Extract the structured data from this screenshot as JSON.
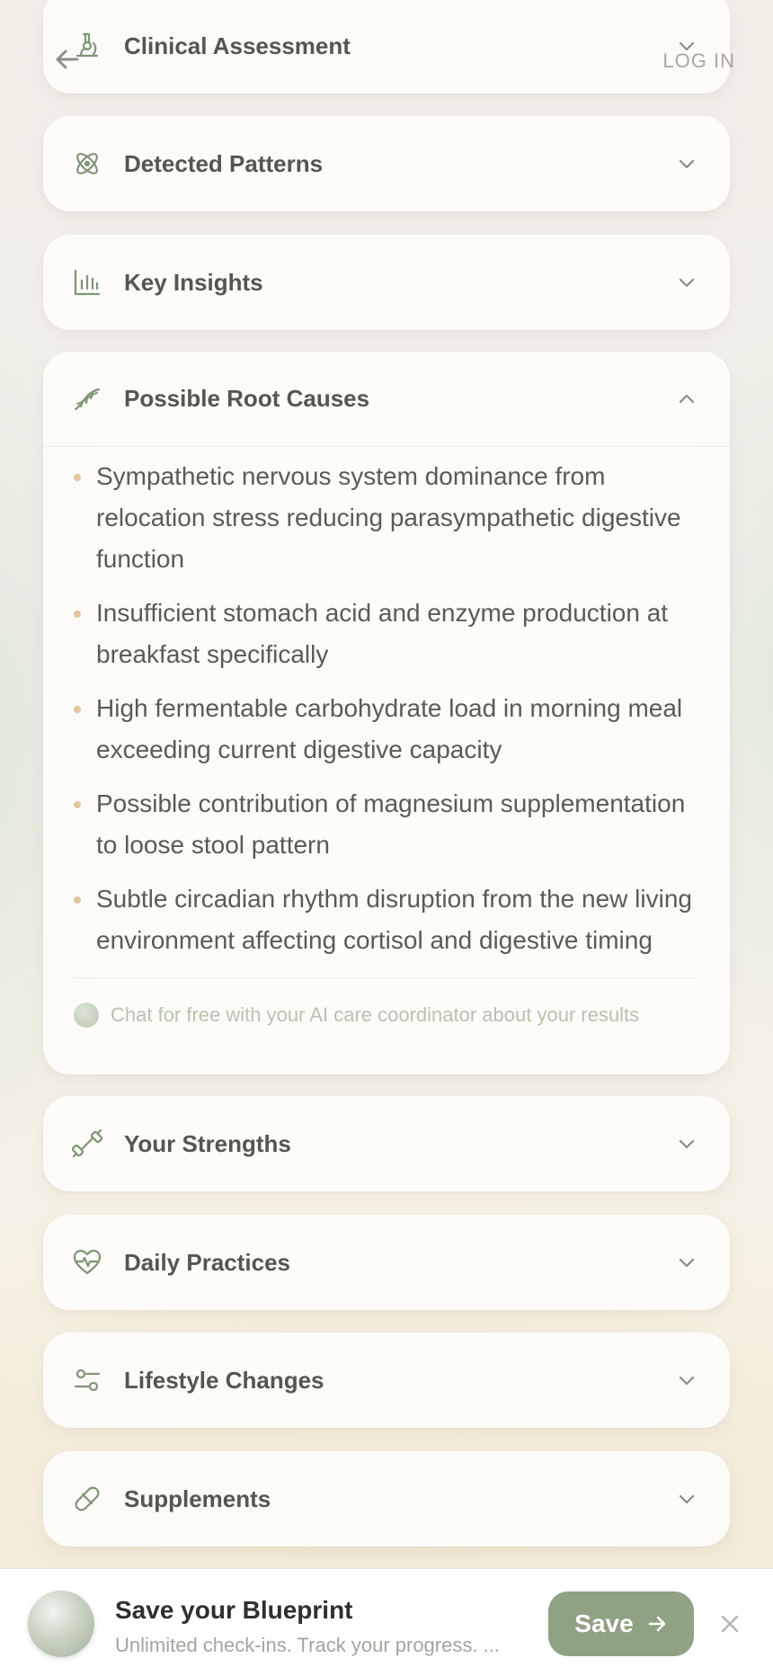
{
  "header": {
    "login_label": "LOG IN"
  },
  "sections": [
    {
      "id": "clinical-assessment",
      "title": "Clinical Assessment",
      "icon": "microscope-icon",
      "expanded": false
    },
    {
      "id": "detected-patterns",
      "title": "Detected Patterns",
      "icon": "atom-icon",
      "expanded": false
    },
    {
      "id": "key-insights",
      "title": "Key Insights",
      "icon": "bar-chart-icon",
      "expanded": false
    },
    {
      "id": "possible-root-causes",
      "title": "Possible Root Causes",
      "icon": "dna-icon",
      "expanded": true,
      "items": [
        "Sympathetic nervous system dominance from relocation stress reducing parasympathetic digestive function",
        "Insufficient stomach acid and enzyme production at breakfast specifically",
        "High fermentable carbohydrate load in morning meal exceeding current digestive capacity",
        "Possible contribution of magnesium supplementation to loose stool pattern",
        "Subtle circadian rhythm disruption from the new living environment affecting cortisol and digestive timing"
      ],
      "chat_prompt": "Chat for free with your AI care coordinator about your results"
    },
    {
      "id": "your-strengths",
      "title": "Your Strengths",
      "icon": "dumbbell-icon",
      "expanded": false
    },
    {
      "id": "daily-practices",
      "title": "Daily Practices",
      "icon": "heart-pulse-icon",
      "expanded": false
    },
    {
      "id": "lifestyle-changes",
      "title": "Lifestyle Changes",
      "icon": "sliders-icon",
      "expanded": false
    },
    {
      "id": "supplements",
      "title": "Supplements",
      "icon": "pill-icon",
      "expanded": false
    }
  ],
  "save_banner": {
    "title": "Save your Blueprint",
    "subtitle": "Unlimited check-ins. Track your progress. ...",
    "button_label": "Save"
  },
  "colors": {
    "accent": "#8fa283",
    "icon": "#7f9577",
    "bullet": "#e0c69a"
  }
}
